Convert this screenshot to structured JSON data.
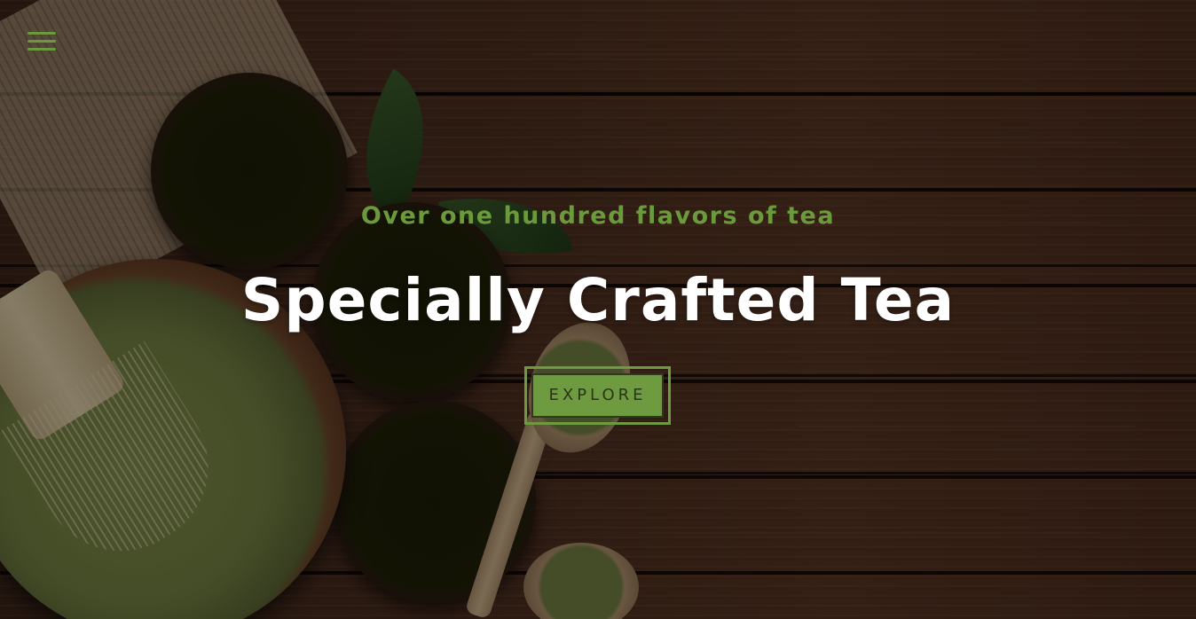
{
  "menu": {
    "icon": "hamburger-menu-icon"
  },
  "hero": {
    "tagline": "Over one hundred flavors of tea",
    "title": "Specially Crafted Tea",
    "button_label": "EXPLORE"
  },
  "colors": {
    "accent": "#6b9a3c",
    "title": "#ffffff",
    "button_bg": "#6f9b40",
    "button_text": "#2a3518",
    "wood": "#4a2d1e"
  }
}
